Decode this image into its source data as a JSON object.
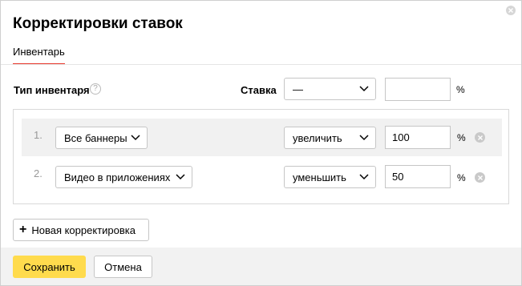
{
  "dialog": {
    "title": "Корректировки ставок",
    "tab": "Инвентарь"
  },
  "header": {
    "type_label": "Тип инвентаря",
    "help_glyph": "?",
    "rate_label": "Ставка",
    "rate_select": "—",
    "rate_value": "",
    "percent": "%"
  },
  "rows": [
    {
      "num": "1.",
      "inventory": "Все баннеры",
      "action": "увеличить",
      "value": "100",
      "percent": "%"
    },
    {
      "num": "2.",
      "inventory": "Видео в приложениях",
      "action": "уменьшить",
      "value": "50",
      "percent": "%"
    }
  ],
  "buttons": {
    "new_plus": "+",
    "new_label": "Новая корректировка",
    "save": "Сохранить",
    "cancel": "Отмена"
  },
  "colors": {
    "accent_tab": "#e8392c",
    "save_button": "#ffdb4d",
    "row_shade": "#f1f1f1"
  }
}
